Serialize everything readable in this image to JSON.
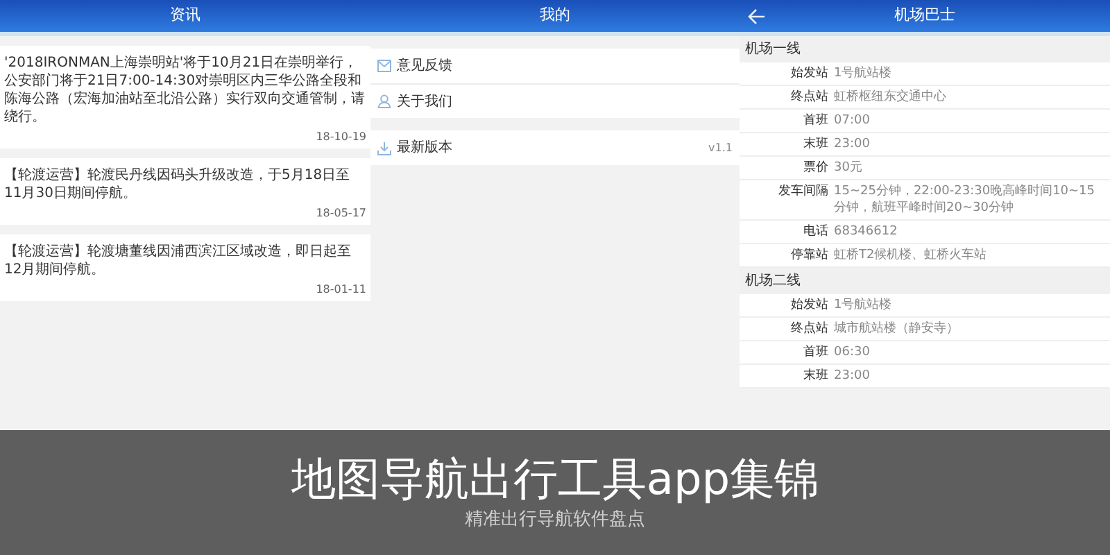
{
  "news_panel": {
    "title": "资讯",
    "items": [
      {
        "text": "'2018IRONMAN上海崇明站'将于10月21日在崇明举行，公安部门将于21日7:00-14:30对崇明区内三华公路全段和陈海公路（宏海加油站至北沿公路）实行双向交通管制，请绕行。",
        "date": "18-10-19"
      },
      {
        "text": "【轮渡运营】轮渡民丹线因码头升级改造，于5月18日至11月30日期间停航。",
        "date": "18-05-17"
      },
      {
        "text": "【轮渡运营】轮渡塘董线因浦西滨江区域改造，即日起至12月期间停航。",
        "date": "18-01-11"
      }
    ]
  },
  "mine_panel": {
    "title": "我的",
    "groups": [
      [
        {
          "kind": "feedback",
          "label": "意见反馈"
        },
        {
          "kind": "about",
          "label": "关于我们"
        }
      ],
      [
        {
          "kind": "version",
          "label": "最新版本",
          "value": "v1.1"
        }
      ]
    ]
  },
  "bus_panel": {
    "title": "机场巴士",
    "back": true,
    "lines": [
      {
        "name": "机场一线",
        "rows": [
          {
            "label": "始发站",
            "value": "1号航站楼"
          },
          {
            "label": "终点站",
            "value": "虹桥枢纽东交通中心"
          },
          {
            "label": "首班",
            "value": "07:00"
          },
          {
            "label": "末班",
            "value": "23:00"
          },
          {
            "label": "票价",
            "value": "30元"
          },
          {
            "label": "发车间隔",
            "value": "15~25分钟，22:00-23:30晚高峰时间10~15分钟，航班平峰时间20~30分钟"
          },
          {
            "label": "电话",
            "value": "68346612"
          },
          {
            "label": "停靠站",
            "value": "虹桥T2候机楼、虹桥火车站"
          }
        ]
      },
      {
        "name": "机场二线",
        "rows": [
          {
            "label": "始发站",
            "value": "1号航站楼"
          },
          {
            "label": "终点站",
            "value": "城市航站楼（静安寺）"
          },
          {
            "label": "首班",
            "value": "06:30"
          },
          {
            "label": "末班",
            "value": "23:00"
          }
        ]
      }
    ]
  },
  "caption": {
    "title": "地图导航出行工具app集锦",
    "subtitle": "精准出行导航软件盘点"
  }
}
